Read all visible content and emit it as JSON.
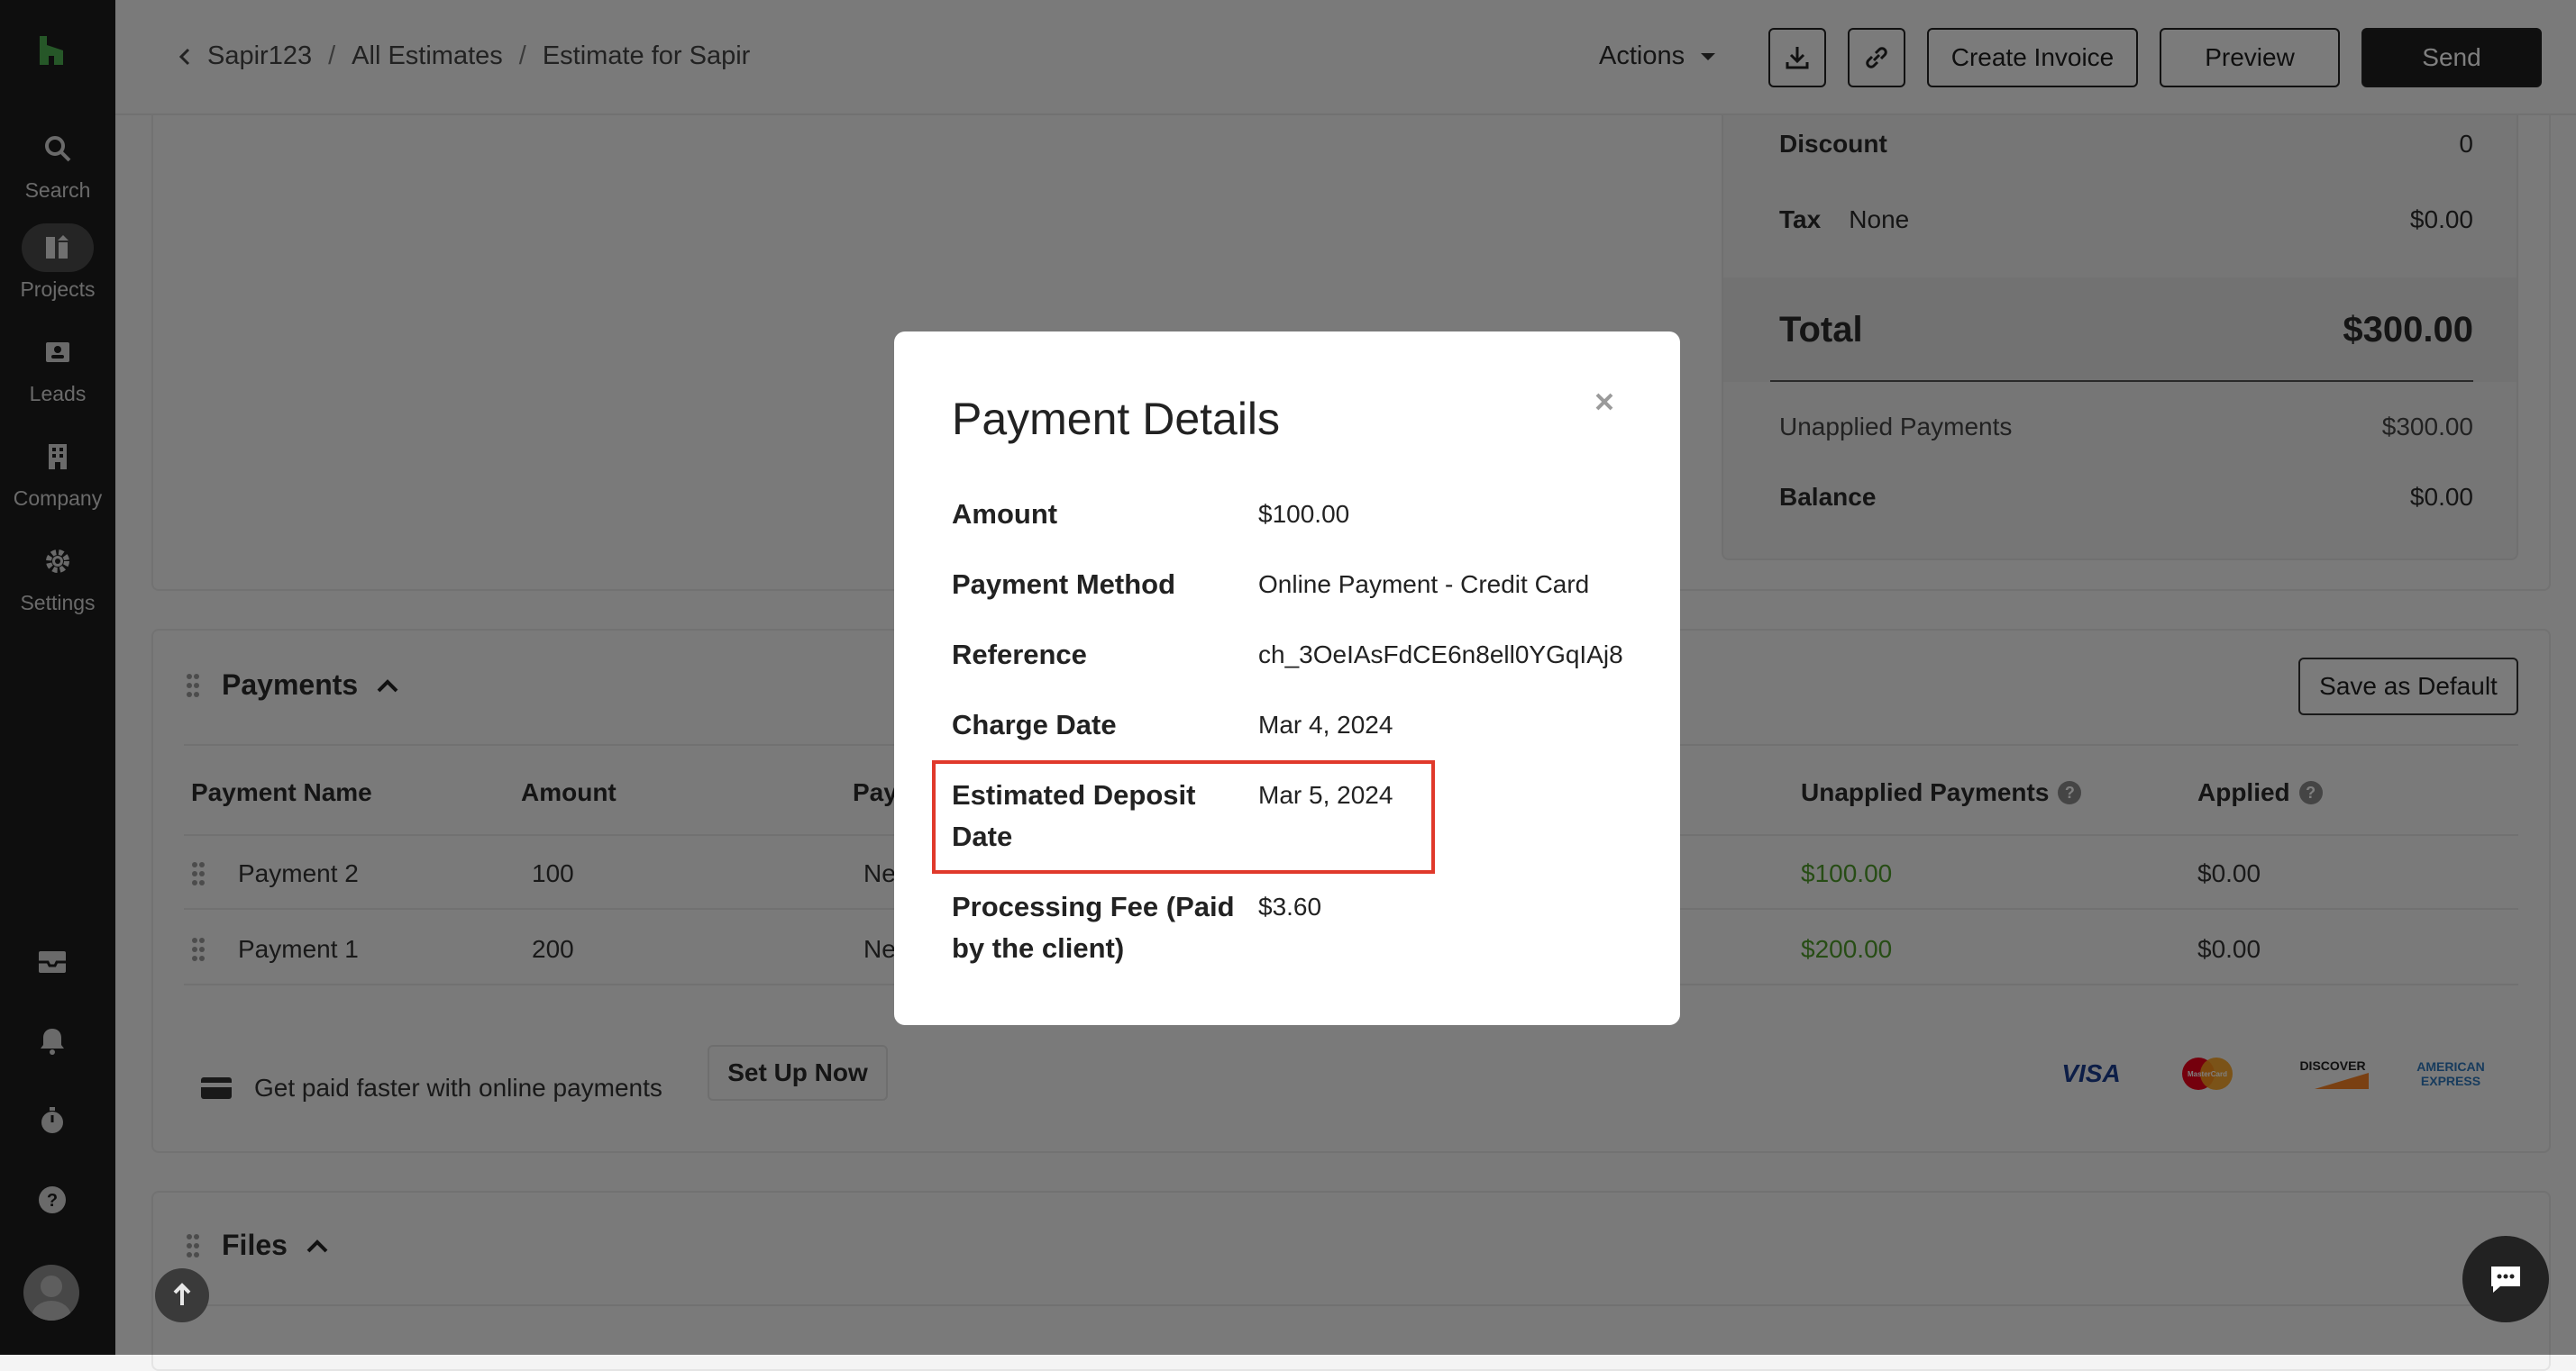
{
  "sidebar": {
    "items": [
      {
        "label": "Search",
        "icon": "search-icon"
      },
      {
        "label": "Projects",
        "icon": "projects-icon",
        "active": true
      },
      {
        "label": "Leads",
        "icon": "leads-icon"
      },
      {
        "label": "Company",
        "icon": "company-icon"
      },
      {
        "label": "Settings",
        "icon": "gear-icon"
      }
    ],
    "bottom_icons": [
      "inbox-icon",
      "bell-icon",
      "timer-icon",
      "help-icon"
    ]
  },
  "header": {
    "breadcrumb": [
      "Sapir123",
      "All Estimates",
      "Estimate for Sapir"
    ],
    "actions_label": "Actions",
    "create_invoice": "Create Invoice",
    "preview": "Preview",
    "send": "Send"
  },
  "summary": {
    "discount_label": "Discount",
    "discount_value": "0",
    "tax_label": "Tax",
    "tax_type": "None",
    "tax_value": "$0.00",
    "total_label": "Total",
    "total_value": "$300.00",
    "unapplied_label": "Unapplied Payments",
    "unapplied_value": "$300.00",
    "balance_label": "Balance",
    "balance_value": "$0.00"
  },
  "payments": {
    "title": "Payments",
    "save_default": "Save as Default",
    "columns": [
      "Payment Name",
      "Amount",
      "Pay",
      "Unapplied Payments",
      "Applied"
    ],
    "rows": [
      {
        "name": "Payment 2",
        "amount": "100",
        "pay": "Ne",
        "unapplied": "$100.00",
        "applied": "$0.00"
      },
      {
        "name": "Payment 1",
        "amount": "200",
        "pay": "Ne",
        "unapplied": "$200.00",
        "applied": "$0.00"
      }
    ],
    "promo_text": "Get paid faster with online payments",
    "promo_button": "Set Up Now",
    "card_brands": [
      "VISA",
      "MasterCard",
      "DISCOVER",
      "AMERICAN EXPRESS"
    ]
  },
  "files": {
    "title": "Files"
  },
  "modal": {
    "title": "Payment Details",
    "rows": [
      {
        "label": "Amount",
        "value": "$100.00"
      },
      {
        "label": "Payment Method",
        "value": "Online Payment - Credit Card"
      },
      {
        "label": "Reference",
        "value": "ch_3OeIAsFdCE6n8ell0YGqIAj8"
      },
      {
        "label": "Charge Date",
        "value": "Mar 4, 2024"
      },
      {
        "label": "Estimated Deposit Date",
        "value": "Mar 5, 2024"
      },
      {
        "label": "Processing Fee (Paid by the client)",
        "value": "$3.60"
      }
    ]
  },
  "colors": {
    "accent_green": "#4f9a2a",
    "highlight_red": "#e0392b",
    "sidebar_bg": "#1c1c1c"
  }
}
